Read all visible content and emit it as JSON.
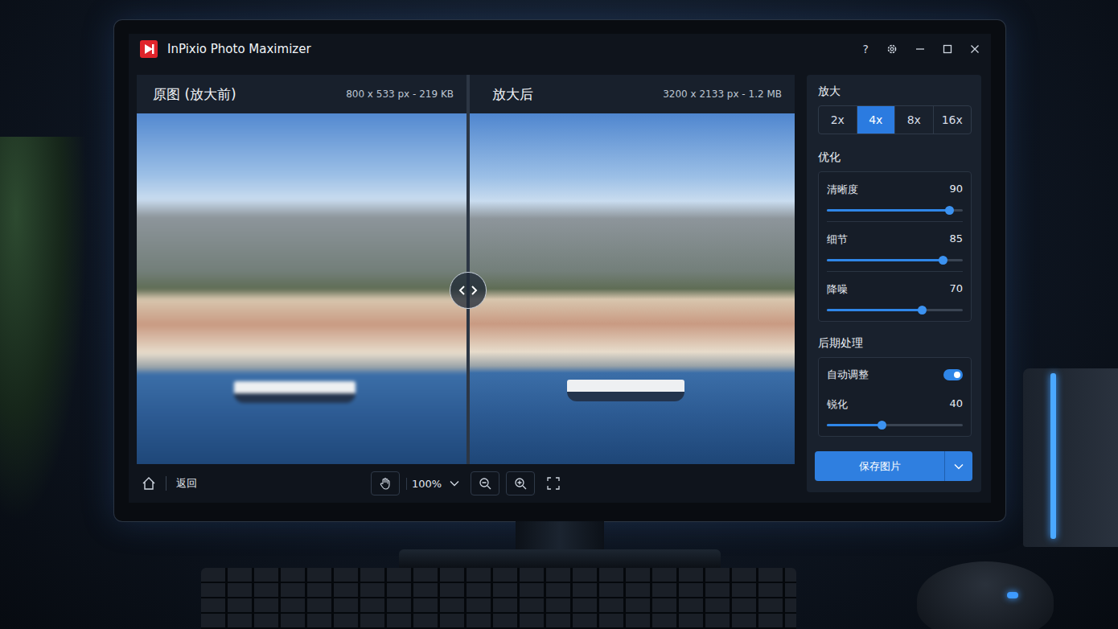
{
  "window": {
    "title": "InPixio Photo Maximizer",
    "help": "?"
  },
  "compare": {
    "before": {
      "title": "原图 (放大前)",
      "meta": "800 x 533 px - 219 KB"
    },
    "after": {
      "title": "放大后",
      "meta": "3200 x 2133 px - 1.2 MB"
    }
  },
  "toolbar": {
    "back": "返回",
    "zoom": "100%"
  },
  "sidebar": {
    "scale": {
      "label": "放大",
      "options": [
        {
          "label": "2x",
          "selected": false
        },
        {
          "label": "4x",
          "selected": true
        },
        {
          "label": "8x",
          "selected": false
        },
        {
          "label": "16x",
          "selected": false
        }
      ]
    },
    "optimize": {
      "label": "优化",
      "sliders": [
        {
          "label": "清晰度",
          "value": "90",
          "level": 0.9
        },
        {
          "label": "细节",
          "value": "85",
          "level": 0.85
        },
        {
          "label": "降噪",
          "value": "70",
          "level": 0.7
        }
      ]
    },
    "post": {
      "label": "后期处理",
      "items": [
        {
          "kind": "toggle",
          "label": "自动调整",
          "on": true
        },
        {
          "kind": "slider",
          "label": "锐化",
          "value": "40",
          "level": 0.4
        }
      ]
    },
    "save": {
      "label": "保存图片"
    }
  }
}
